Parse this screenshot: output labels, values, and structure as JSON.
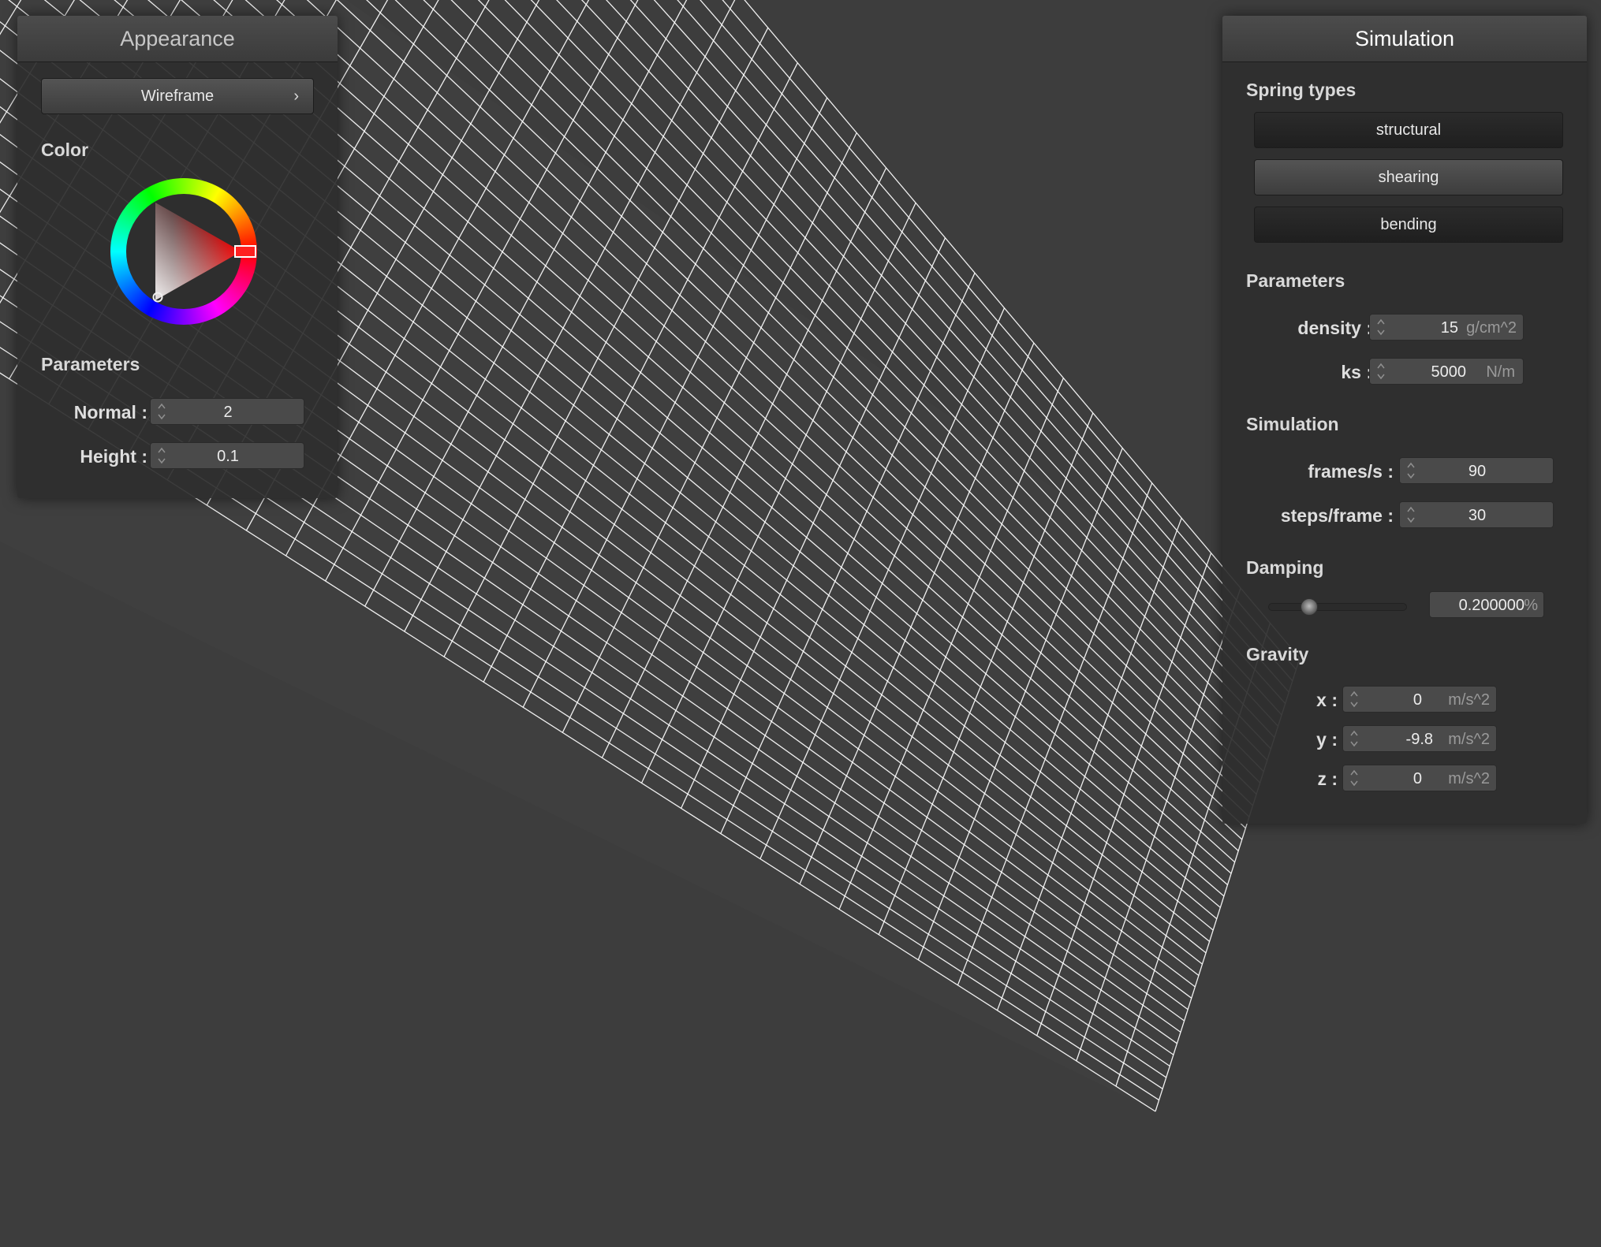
{
  "appearance": {
    "title": "Appearance",
    "mode": "Wireframe",
    "color_label": "Color",
    "selected_color": "#ff0000",
    "parameters_label": "Parameters",
    "normal_label": "Normal :",
    "normal_value": "2",
    "height_label": "Height :",
    "height_value": "0.1"
  },
  "simulation": {
    "title": "Simulation",
    "spring_types_label": "Spring types",
    "springs": [
      "structural",
      "shearing",
      "bending"
    ],
    "parameters_label": "Parameters",
    "density_label": "density :",
    "density_value": "15",
    "density_unit": "g/cm^2",
    "ks_label": "ks :",
    "ks_value": "5000",
    "ks_unit": "N/m",
    "simulation_label": "Simulation",
    "fps_label": "frames/s :",
    "fps_value": "90",
    "steps_label": "steps/frame :",
    "steps_value": "30",
    "damping_label": "Damping",
    "damping_slider_fraction": 0.2,
    "damping_value": "0.200000",
    "damping_unit": "%",
    "gravity_label": "Gravity",
    "gx_label": "x :",
    "gx_value": "0",
    "gy_label": "y :",
    "gy_value": "-9.8",
    "gz_label": "z :",
    "gz_value": "0",
    "gravity_unit": "m/s^2"
  },
  "colors": {
    "background": "#3d3d3d",
    "panel": "#2e2e2e",
    "wireframe": "#ffffff"
  }
}
